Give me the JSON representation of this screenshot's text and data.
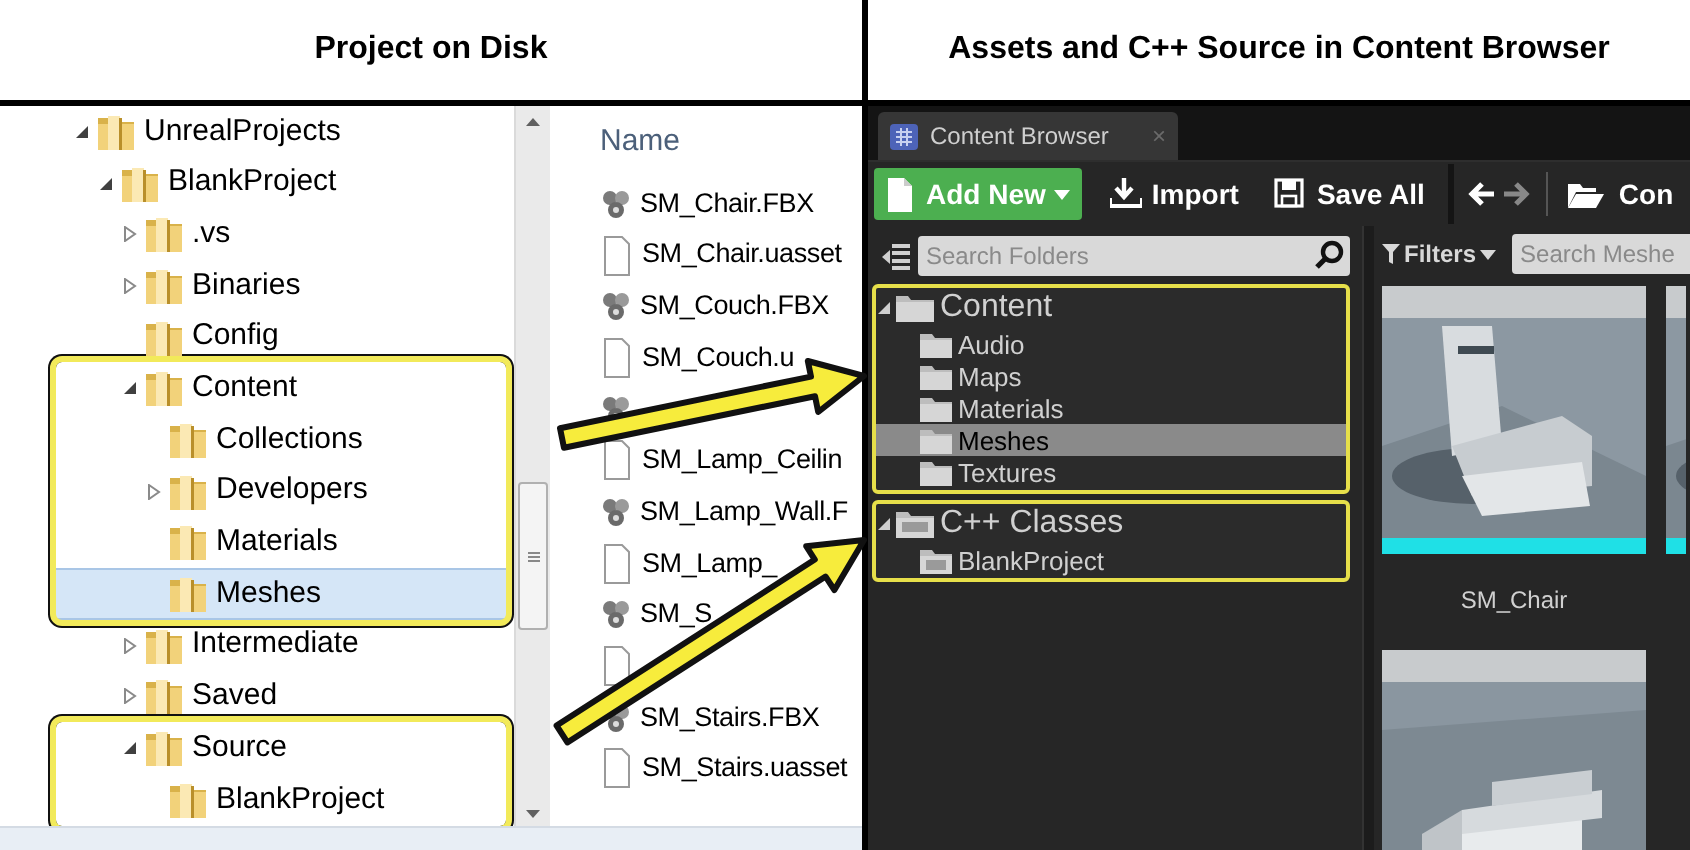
{
  "headings": [
    {
      "text": "Project on Disk"
    },
    {
      "text": "Assets and C++ Source in Content Browser"
    }
  ],
  "explorer": {
    "tree": [
      {
        "label": "UnrealProjects",
        "expandable": true,
        "expanded": true,
        "selected": false,
        "highlighted": false,
        "children": [
          {
            "label": "BlankProject",
            "expandable": true,
            "expanded": true,
            "selected": false,
            "highlighted": false,
            "children": [
              {
                "label": ".vs",
                "expandable": true,
                "expanded": false,
                "selected": false,
                "highlighted": false
              },
              {
                "label": "Binaries",
                "expandable": true,
                "expanded": false,
                "selected": false,
                "highlighted": false
              },
              {
                "label": "Config",
                "expandable": false,
                "selected": false,
                "highlighted": false
              },
              {
                "label": "Content",
                "expandable": true,
                "expanded": true,
                "selected": false,
                "highlighted": true,
                "children": [
                  {
                    "label": "Collections",
                    "expandable": false,
                    "selected": false,
                    "highlighted": false
                  },
                  {
                    "label": "Developers",
                    "expandable": true,
                    "expanded": false,
                    "selected": false,
                    "highlighted": false
                  },
                  {
                    "label": "Materials",
                    "expandable": false,
                    "selected": false,
                    "highlighted": false
                  },
                  {
                    "label": "Meshes",
                    "expandable": false,
                    "selected": true,
                    "highlighted": false
                  }
                ]
              },
              {
                "label": "Intermediate",
                "expandable": true,
                "expanded": false,
                "selected": false,
                "highlighted": false
              },
              {
                "label": "Saved",
                "expandable": true,
                "expanded": false,
                "selected": false,
                "highlighted": false
              },
              {
                "label": "Source",
                "expandable": true,
                "expanded": true,
                "selected": false,
                "highlighted": true,
                "children": [
                  {
                    "label": "BlankProject",
                    "expandable": false,
                    "selected": false,
                    "highlighted": false
                  }
                ]
              }
            ]
          }
        ]
      }
    ],
    "column_header": "Name",
    "files": [
      {
        "name": "SM_Chair.FBX",
        "kind": "fbx"
      },
      {
        "name": "SM_Chair.uasset",
        "kind": "file"
      },
      {
        "name": "SM_Couch.FBX",
        "kind": "fbx"
      },
      {
        "name": "SM_Couch.u",
        "kind": "file"
      },
      {
        "kind": "fbx"
      },
      {
        "name": "SM_Lamp_Ceilin",
        "kind": "file"
      },
      {
        "name": "SM_Lamp_Wall.F",
        "kind": "fbx"
      },
      {
        "name": "SM_Lamp_",
        "kind": "file"
      },
      {
        "name": "SM_S",
        "kind": "fbx"
      },
      {
        "kind": "file"
      },
      {
        "name": "SM_Stairs.FBX",
        "kind": "fbx"
      },
      {
        "name": "SM_Stairs.uasset",
        "kind": "file"
      }
    ]
  },
  "content_browser": {
    "tab": {
      "label": "Content Browser",
      "close": "×"
    },
    "toolbar": [
      {
        "label": "Add New",
        "kind": "add"
      },
      {
        "label": "Import",
        "kind": "import"
      },
      {
        "label": "Save All",
        "kind": "save"
      }
    ],
    "path": "Con",
    "folder_search": {
      "placeholder": "Search Folders"
    },
    "filters": "Filters",
    "asset_search": {
      "placeholder": "Search Meshe"
    },
    "tree": [
      {
        "label": "Content",
        "kind": "folder",
        "expandable": true,
        "expanded": true,
        "selected": false,
        "highlighted": true,
        "children": [
          {
            "label": "Audio",
            "kind": "folder",
            "expandable": false,
            "selected": false,
            "highlighted": false
          },
          {
            "label": "Maps",
            "kind": "folder",
            "expandable": false,
            "selected": false,
            "highlighted": false
          },
          {
            "label": "Materials",
            "kind": "folder",
            "expandable": false,
            "selected": false,
            "highlighted": false
          },
          {
            "label": "Meshes",
            "kind": "folder",
            "expandable": false,
            "selected": true,
            "highlighted": false
          },
          {
            "label": "Textures",
            "kind": "folder",
            "expandable": false,
            "selected": false,
            "highlighted": false
          }
        ]
      },
      {
        "label": "C++ Classes",
        "kind": "cpp",
        "expandable": true,
        "expanded": true,
        "selected": false,
        "highlighted": true,
        "children": [
          {
            "label": "BlankProject",
            "kind": "cpp",
            "expandable": false,
            "selected": false,
            "highlighted": false
          }
        ]
      }
    ],
    "assets": [
      {
        "label": "SM_Chair"
      }
    ]
  }
}
